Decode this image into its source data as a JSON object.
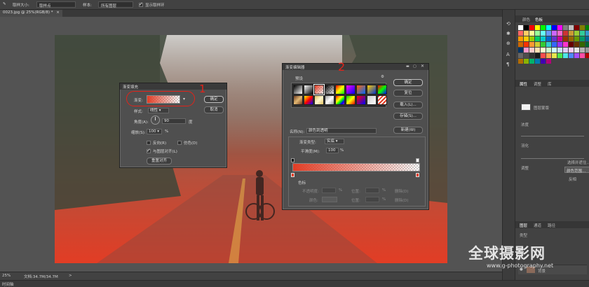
{
  "options_bar": {
    "tool_size_label": "取样大小:",
    "tool_size_value": "取样点",
    "sample_label": "样本:",
    "sample_value": "所有图层",
    "show_ring_label": "显示取样环"
  },
  "document_tab": {
    "label": "0023.jpg @ 25%(RGB/8) *",
    "close": "×"
  },
  "status_bar": {
    "zoom": "25%",
    "doc": "文档:34.7M/34.7M",
    "arrow": ">"
  },
  "timeline": {
    "label": "时间轴"
  },
  "right_panel": {
    "tabs_top": [
      "颜色",
      "色板"
    ],
    "tabs_mid": [
      "属性",
      "调整",
      "库"
    ],
    "properties_label": "图层蒙版",
    "blend_label": "羽化",
    "density_label": "浓度",
    "refine_label": "调整",
    "select_label": "选择并遮住...",
    "color_range_label": "颜色范围...",
    "invert_label": "反相",
    "tabs_bottom": [
      "图层",
      "通道",
      "路径"
    ],
    "layer_kind": "类型",
    "layer_name": "背景",
    "swatches": [
      "#ffffff",
      "#000000",
      "#ff0000",
      "#ffff00",
      "#00ff00",
      "#00ffff",
      "#0000ff",
      "#ff00ff",
      "#808080",
      "#c0c0c0",
      "#800000",
      "#808000",
      "#008000",
      "#ff6666",
      "#ffcc66",
      "#ffff99",
      "#99ff99",
      "#66ffff",
      "#6699ff",
      "#cc66ff",
      "#ff66cc",
      "#cc3333",
      "#cc9933",
      "#99cc33",
      "#33cc99",
      "#3399cc",
      "#ff9900",
      "#ffcc00",
      "#99cc00",
      "#00cc66",
      "#00cccc",
      "#0066cc",
      "#6633cc",
      "#cc0099",
      "#993300",
      "#996600",
      "#669900",
      "#009966",
      "#006699",
      "#cc6600",
      "#ff3300",
      "#ff9933",
      "#cccc33",
      "#33cc33",
      "#33cccc",
      "#3366ff",
      "#9933ff",
      "#ff33cc",
      "#660000",
      "#663300",
      "#336600",
      "#006633",
      "#003366",
      "#ff99cc",
      "#ffcccc",
      "#ffe0b3",
      "#ffffcc",
      "#ccffcc",
      "#ccffff",
      "#cce0ff",
      "#e0ccff",
      "#ffccf2",
      "#e6e6e6",
      "#b3b3b3",
      "#999999",
      "#666666",
      "#4d4d4d",
      "#333333",
      "#1a1a1a",
      "#ff4d4d",
      "#ffa64d",
      "#e6e64d",
      "#4de64d",
      "#4de6e6",
      "#4d88ff",
      "#a64dff",
      "#ff4da6",
      "#b30000",
      "#b36b00",
      "#8ab300",
      "#00b36b",
      "#007ab3",
      "#4000b3",
      "#b3007a"
    ]
  },
  "fill_dialog": {
    "title": "渐变填充",
    "gradient_label": "渐变:",
    "style_label": "样式:",
    "style_value": "线性",
    "angle_label": "角度(A):",
    "angle_value": "90",
    "angle_unit": "度",
    "scale_label": "缩放(S):",
    "scale_value": "100",
    "scale_unit": "%",
    "reverse_label": "反向(R)",
    "dither_label": "仿色(D)",
    "align_label": "与图层对齐(L)",
    "reset_label": "重置对齐",
    "ok": "确定",
    "cancel": "取消",
    "annotation": "1"
  },
  "editor_dialog": {
    "title": "渐变编辑器",
    "presets_label": "预设",
    "gear": "⚙",
    "ok": "确定",
    "reset": "复位",
    "load": "载入(L)...",
    "save": "存储(S)...",
    "name_label": "名称(N):",
    "name_value": "颜色到透明",
    "new_label": "新建(W)",
    "type_label": "渐变类型:",
    "type_value": "实底",
    "smooth_label": "平滑度(M):",
    "smooth_value": "100",
    "smooth_unit": "%",
    "stops_label": "色标",
    "opacity_label": "不透明度:",
    "location_label": "位置:",
    "delete_label": "删除(D)",
    "color_label": "颜色:",
    "percent": "%",
    "annotation": "2",
    "presets": [
      "linear-gradient(135deg,#000,#fff)",
      "linear-gradient(135deg,#fff,#000)",
      "linear-gradient(135deg,#e23d25,transparent)",
      "linear-gradient(135deg,#000,transparent)",
      "linear-gradient(135deg,#ff0000,#ffff00,#00ff00)",
      "linear-gradient(135deg,#ff00ff,#0000ff)",
      "linear-gradient(135deg,#ff6600,#0066ff)",
      "linear-gradient(135deg,#ffcc00,#0033cc)",
      "linear-gradient(135deg,#ff0000,#00ff00,#0000ff)",
      "linear-gradient(135deg,#6b3a1f,#e3b873,#6b3a1f)",
      "linear-gradient(135deg,#ff0,#f00,#00f)",
      "linear-gradient(135deg,#e0c060,#fff8d0,#e0c060)",
      "linear-gradient(135deg,#999,#fff,#999)",
      "linear-gradient(135deg,#ff0000,#ff9900,#ffff00,#00ff00,#0000ff,#9900ff)",
      "linear-gradient(135deg,#00cc00,#ffff00,#ff0000)",
      "linear-gradient(135deg,#ff0000,#0000ff)",
      "linear-gradient(135deg,#cccccc,#ffffff)",
      "repeating-linear-gradient(135deg,#e23d25 0 2px,#fff 2px 4px)"
    ]
  }
}
